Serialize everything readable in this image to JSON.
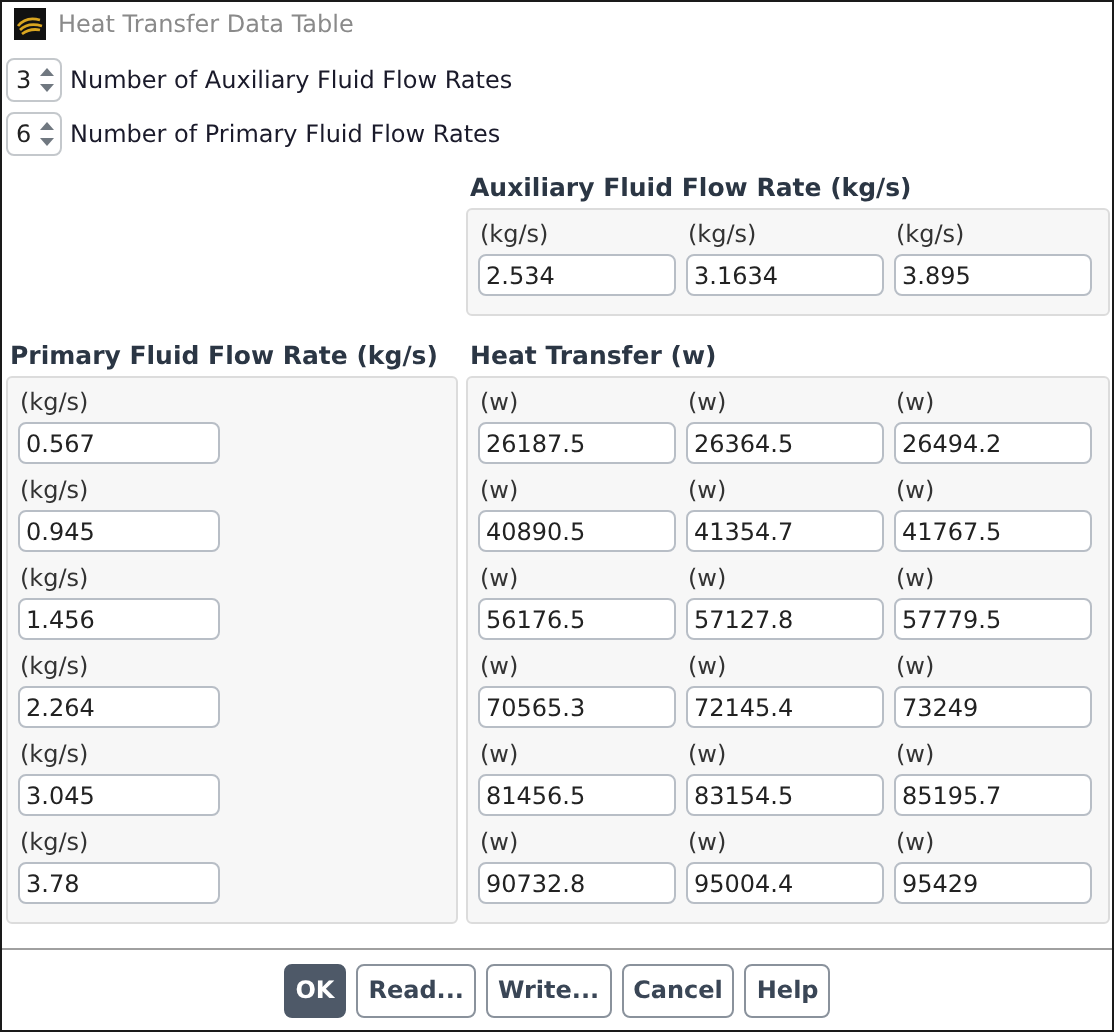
{
  "window": {
    "title": "Heat Transfer Data Table"
  },
  "counts": [
    {
      "value": "3",
      "label": "Number of Auxiliary Fluid Flow Rates"
    },
    {
      "value": "6",
      "label": "Number of Primary Fluid Flow Rates"
    }
  ],
  "auxiliary": {
    "title": "Auxiliary Fluid Flow Rate (kg/s)",
    "fields": [
      {
        "unit": "(kg/s)",
        "value": "2.534"
      },
      {
        "unit": "(kg/s)",
        "value": "3.1634"
      },
      {
        "unit": "(kg/s)",
        "value": "3.895"
      }
    ]
  },
  "primary": {
    "title": "Primary Fluid Flow Rate (kg/s)",
    "fields": [
      {
        "unit": "(kg/s)",
        "value": "0.567"
      },
      {
        "unit": "(kg/s)",
        "value": "0.945"
      },
      {
        "unit": "(kg/s)",
        "value": "1.456"
      },
      {
        "unit": "(kg/s)",
        "value": "2.264"
      },
      {
        "unit": "(kg/s)",
        "value": "3.045"
      },
      {
        "unit": "(kg/s)",
        "value": "3.78"
      }
    ]
  },
  "heat_transfer": {
    "title": "Heat Transfer (w)",
    "rows": [
      [
        {
          "unit": "(w)",
          "value": "26187.5"
        },
        {
          "unit": "(w)",
          "value": "26364.5"
        },
        {
          "unit": "(w)",
          "value": "26494.2"
        }
      ],
      [
        {
          "unit": "(w)",
          "value": "40890.5"
        },
        {
          "unit": "(w)",
          "value": "41354.7"
        },
        {
          "unit": "(w)",
          "value": "41767.5"
        }
      ],
      [
        {
          "unit": "(w)",
          "value": "56176.5"
        },
        {
          "unit": "(w)",
          "value": "57127.8"
        },
        {
          "unit": "(w)",
          "value": "57779.5"
        }
      ],
      [
        {
          "unit": "(w)",
          "value": "70565.3"
        },
        {
          "unit": "(w)",
          "value": "72145.4"
        },
        {
          "unit": "(w)",
          "value": "73249"
        }
      ],
      [
        {
          "unit": "(w)",
          "value": "81456.5"
        },
        {
          "unit": "(w)",
          "value": "83154.5"
        },
        {
          "unit": "(w)",
          "value": "85195.7"
        }
      ],
      [
        {
          "unit": "(w)",
          "value": "90732.8"
        },
        {
          "unit": "(w)",
          "value": "95004.4"
        },
        {
          "unit": "(w)",
          "value": "95429"
        }
      ]
    ]
  },
  "buttons": [
    {
      "label": "OK",
      "kind": "primary"
    },
    {
      "label": "Read...",
      "kind": "secondary"
    },
    {
      "label": "Write...",
      "kind": "secondary"
    },
    {
      "label": "Cancel",
      "kind": "secondary"
    },
    {
      "label": "Help",
      "kind": "secondary"
    }
  ]
}
